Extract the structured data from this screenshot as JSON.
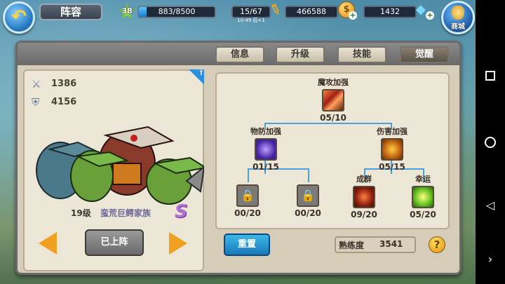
{
  "header": {
    "title": "阵容",
    "level": "38",
    "exp_text": "883/8500",
    "exp_fraction": 0.104,
    "stamina": "15/67",
    "stamina_timer": "10:49 后+1",
    "gold": "466588",
    "gems": "1432",
    "shop_label": "商城"
  },
  "tabs": [
    {
      "label": "信息"
    },
    {
      "label": "升级"
    },
    {
      "label": "技能"
    },
    {
      "label": "觉醒",
      "active": true
    }
  ],
  "hero": {
    "attack": "1386",
    "defense": "4156",
    "level": "19级",
    "name": "蛮荒巨鳄家族",
    "rank": "S",
    "deploy_label": "已上阵"
  },
  "awaken_tree": {
    "root": {
      "name": "魔攻加强",
      "count": "05/10",
      "icon": "magic-attack-icon"
    },
    "left": {
      "name": "物防加强",
      "count": "01/15",
      "icon": "physical-defense-icon"
    },
    "right": {
      "name": "伤害加强",
      "count": "05/15",
      "icon": "damage-boost-icon"
    },
    "leaves": [
      {
        "name": "",
        "count": "00/20",
        "icon": "lock-icon"
      },
      {
        "name": "",
        "count": "00/20",
        "icon": "lock-icon"
      },
      {
        "name": "成群",
        "count": "09/20",
        "icon": "swarm-icon"
      },
      {
        "name": "幸运",
        "count": "05/20",
        "icon": "luck-icon"
      }
    ]
  },
  "footer": {
    "reset_label": "重置",
    "proficiency_label": "熟练度",
    "proficiency_value": "3541",
    "help": "?"
  }
}
